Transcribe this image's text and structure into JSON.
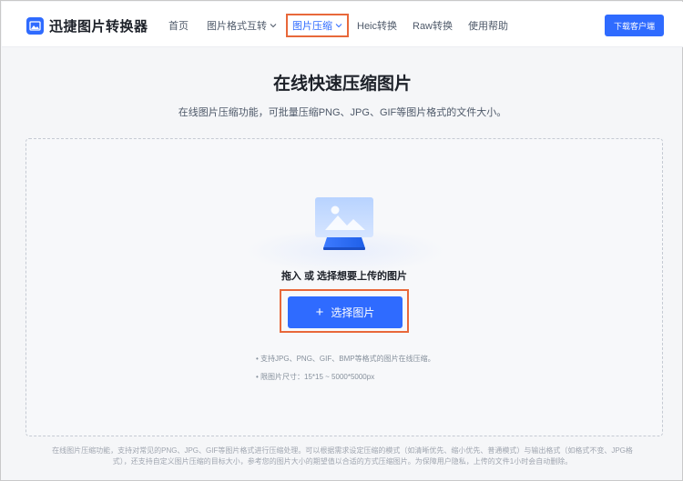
{
  "header": {
    "logo_text": "迅捷图片转换器",
    "nav": [
      {
        "label": "首页"
      },
      {
        "label": "图片格式互转"
      },
      {
        "label": "图片压缩"
      },
      {
        "label": "Heic转换"
      },
      {
        "label": "Raw转换"
      },
      {
        "label": "使用帮助"
      }
    ],
    "download_label": "下载客户端"
  },
  "main": {
    "title": "在线快速压缩图片",
    "subtitle": "在线图片压缩功能，可批量压缩PNG、JPG、GIF等图片格式的文件大小。",
    "dropzone": {
      "prompt": "拖入 或 选择想要上传的图片",
      "select_label": "选择图片",
      "tips": [
        "• 支持JPG、PNG、GIF、BMP等格式的图片在线压缩。",
        "• 限图片尺寸：15*15 ~ 5000*5000px"
      ]
    }
  },
  "footer_note": "在线图片压缩功能，支持对常见的PNG、JPG、GIF等图片格式进行压缩处理。可以根据需求设定压缩的模式（如清晰优先、缩小优先、普通模式）与输出格式（如格式不变、JPG格式），还支持自定义图片压缩的目标大小，参考您的图片大小的期望值以合适的方式压缩图片。为保障用户隐私，上传的文件1小时会自动删除。",
  "colors": {
    "accent": "#2f6bff",
    "highlight_outline": "#e8683a"
  },
  "icons": {
    "logo": "image-logo-icon",
    "illustration": "image-upload-illustration",
    "dropdown": "chevron-down-icon",
    "add": "plus-icon"
  }
}
